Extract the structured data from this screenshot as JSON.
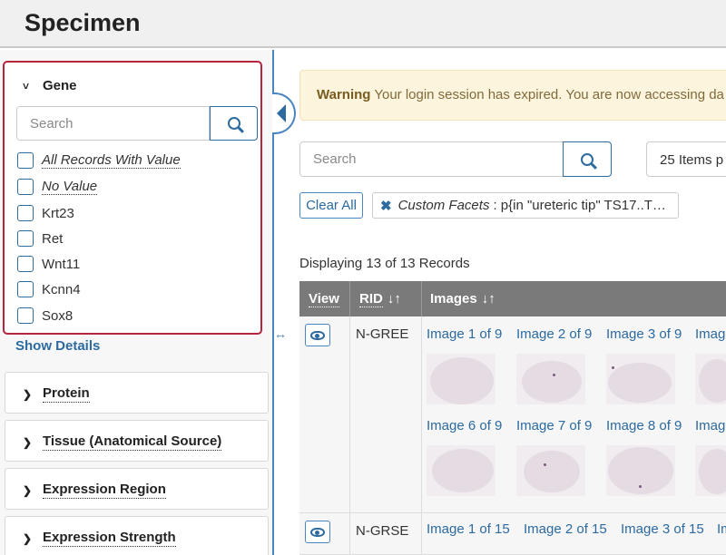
{
  "header": {
    "title": "Specimen"
  },
  "sidebar": {
    "gene": {
      "title": "Gene",
      "search_placeholder": "Search",
      "options": [
        "All Records With Value",
        "No Value",
        "Krt23",
        "Ret",
        "Wnt11",
        "Kcnn4",
        "Sox8"
      ],
      "show_details": "Show Details"
    },
    "facets": [
      "Protein",
      "Tissue (Anatomical Source)",
      "Expression Region",
      "Expression Strength"
    ]
  },
  "main": {
    "warning_bold": "Warning",
    "warning_text": "Your login session has expired. You are now accessing da",
    "search_placeholder": "Search",
    "page_size": "25 Items p",
    "clear_all": "Clear All",
    "filter_label": "Custom Facets",
    "filter_value": ": p{in \"ureteric tip\" TS17..T…",
    "displaying": "Displaying 13 of 13 Records",
    "columns": {
      "view": "View",
      "rid": "RID",
      "images": "Images"
    },
    "rows": [
      {
        "rid": "N-GREE",
        "links_top": [
          "Image 1 of 9",
          "Image 2 of 9",
          "Image 3 of 9",
          "Imag"
        ],
        "links_bottom": [
          "Image 6 of 9",
          "Image 7 of 9",
          "Image 8 of 9",
          "Imag"
        ]
      },
      {
        "rid": "N-GRSE",
        "links_top": [
          "Image 1 of 15",
          "Image 2 of 15",
          "Image 3 of 15",
          "Im"
        ]
      }
    ]
  }
}
